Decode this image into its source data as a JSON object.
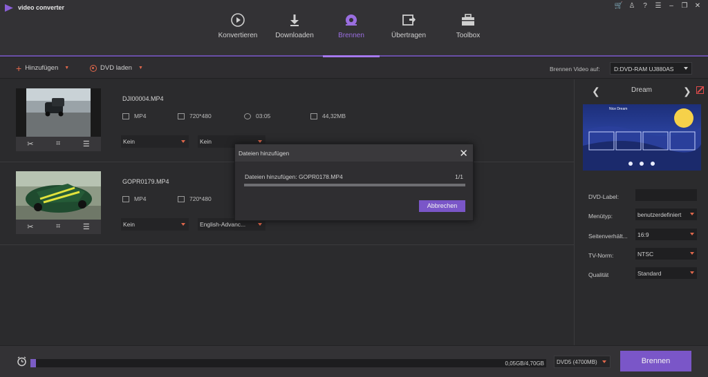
{
  "app": {
    "title": "video converter"
  },
  "window_controls": [
    "cart-icon",
    "user-icon",
    "help-icon",
    "menu-icon",
    "minimize-icon",
    "maximize-icon",
    "close-icon"
  ],
  "nav": {
    "items": [
      {
        "label": "Konvertieren",
        "icon": "convert-icon",
        "active": false
      },
      {
        "label": "Downloaden",
        "icon": "download-icon",
        "active": false
      },
      {
        "label": "Brennen",
        "icon": "burn-disc-icon",
        "active": true
      },
      {
        "label": "Übertragen",
        "icon": "transfer-icon",
        "active": false
      },
      {
        "label": "Toolbox",
        "icon": "toolbox-icon",
        "active": false
      }
    ]
  },
  "toolbar": {
    "add_label": "Hinzufügen",
    "load_dvd_label": "DVD laden",
    "burn_to_label": "Brennen Video auf:",
    "burn_target": "D:DVD-RAM UJ880AS"
  },
  "files": [
    {
      "name": "DJI00004.MP4",
      "format": "MP4",
      "resolution": "720*480",
      "duration": "03:05",
      "size": "44,32MB",
      "subtitle": "Kein",
      "audio": "Kein"
    },
    {
      "name": "GOPR0179.MP4",
      "format": "MP4",
      "resolution": "720*480",
      "subtitle": "Kein",
      "audio": "English-Advanc..."
    }
  ],
  "right_panel": {
    "theme_name": "Dream",
    "preview_title": "Nice Dream",
    "dvd_label_label": "DVD-Label:",
    "dvd_label_value": "",
    "menu_type_label": "Menütyp:",
    "menu_type_value": "benutzerdefiniert",
    "aspect_label": "Seitenverhält...",
    "aspect_value": "16:9",
    "tv_norm_label": "TV-Norm:",
    "tv_norm_value": "NTSC",
    "quality_label": "Qualität",
    "quality_value": "Standard"
  },
  "bottom": {
    "storage_text": "0,05GB/4,70GB",
    "storage_fraction": 0.0106,
    "disc_type": "DVD5 (4700MB)",
    "burn_button": "Brennen"
  },
  "modal": {
    "title": "Dateien hinzufügen",
    "status": "Dateien hinzufügen: GOPR0178.MP4",
    "count": "1/1",
    "progress": 1.0,
    "cancel_label": "Abbrechen"
  },
  "colors": {
    "accent": "#7a56c8",
    "accent_active": "#9a6ee0",
    "warning_red": "#e0674b"
  }
}
